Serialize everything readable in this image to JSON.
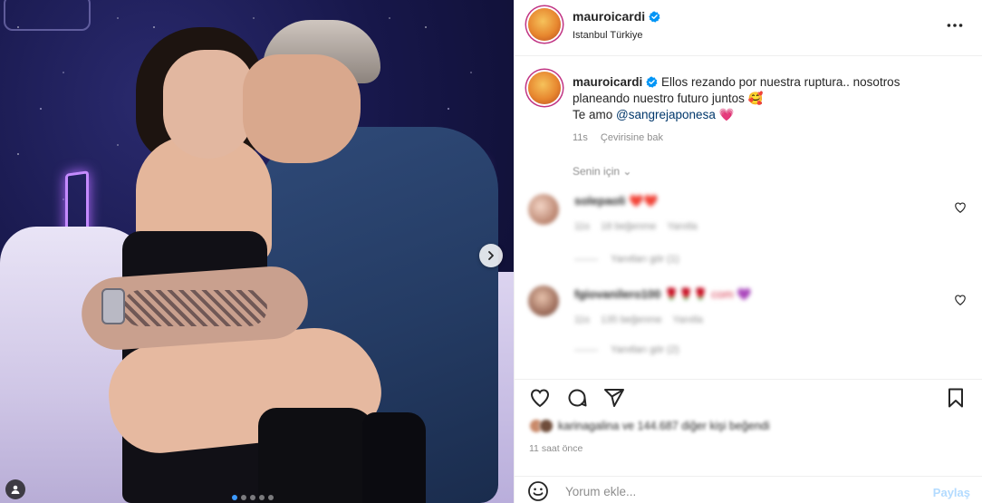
{
  "post": {
    "username": "mauroicardi",
    "location": "Istanbul Türkiye",
    "caption_username": "mauroicardi",
    "caption_line1": "Ellos rezando por nuestra ruptura.. nosotros planeando nuestro futuro juntos",
    "caption_emoji1": "🥰",
    "caption_line2_prefix": "Te amo",
    "caption_mention": "@sangrejaponesa",
    "caption_emoji2": "💗",
    "time": "11s",
    "translate_label": "Çevirisine bak",
    "following_for": "Senin için",
    "time_ago": "11 saat önce"
  },
  "comments": [
    {
      "username": "solepaoli",
      "text": "❤️❤️",
      "time": "11s",
      "likes": "18 beğenme",
      "reply": "Yanıtla",
      "view_replies": "Yanıtları gör (1)"
    },
    {
      "username": "fgiovanilero100",
      "text": "🌹🌹🌹 com 💜",
      "time": "11s",
      "likes": "135 beğenme",
      "reply": "Yanıtla",
      "view_replies": "Yanıtları gör (2)"
    }
  ],
  "likes_line": "karinagalina ve 144.687 diğer kişi beğendi",
  "composer": {
    "placeholder": "Yorum ekle...",
    "post_label": "Paylaş"
  },
  "carousel": {
    "total_slides": 5,
    "active_index": 0
  },
  "colors": {
    "verified": "#0095f6",
    "mention": "#00376b",
    "muted": "#8e8e8e",
    "post_disabled": "#b3dbff",
    "story_ring": "#c13584"
  },
  "icons": {
    "verified": "verified-badge-icon",
    "more": "more-options-icon",
    "like": "heart-icon",
    "comment": "comment-icon",
    "share": "share-icon",
    "save": "bookmark-icon",
    "emoji": "emoji-icon",
    "next": "chevron-right-icon",
    "tag": "user-tag-icon"
  }
}
